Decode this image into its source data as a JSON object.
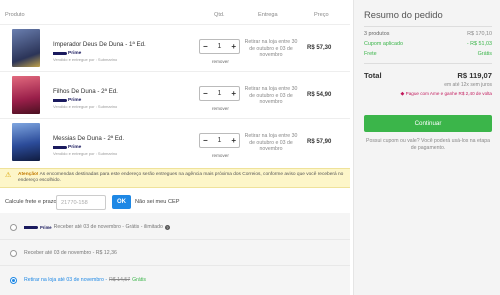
{
  "cart": {
    "headers": {
      "product": "Produto",
      "qty": "Qtd.",
      "delivery": "Entrega",
      "price": "Preço"
    },
    "items": [
      {
        "title": "Imperador Deus De Duna - 1ª Ed.",
        "prime": "Prime",
        "seller": "Vendido e entregue por : Submarino",
        "qty": "1",
        "delivery": "Retirar na loja entre 30 de outubro e 03 de novembro",
        "price": "R$ 57,30",
        "remove": "remover",
        "cover_color": "#3a4a7a"
      },
      {
        "title": "Filhos De Duna - 2ª Ed.",
        "prime": "Prime",
        "seller": "Vendido e entregue por : Submarino",
        "qty": "1",
        "delivery": "Retirar na loja entre 30 de outubro e 03 de novembro",
        "price": "R$ 54,90",
        "remove": "remover",
        "cover_color": "#b5345a"
      },
      {
        "title": "Messias De Duna - 2ª Ed.",
        "prime": "Prime",
        "seller": "Vendido e entregue por : Submarino",
        "qty": "1",
        "delivery": "Retirar na loja entre 30 de outubro e 03 de novembro",
        "price": "R$ 57,90",
        "remove": "remover",
        "cover_color": "#3a5fa8"
      }
    ],
    "qty_minus": "−",
    "qty_plus": "+"
  },
  "notice": {
    "bold": "Atenção!",
    "text": " As encomendas destinadas para este endereço serão entregues na agência mais próxima dos Correios, conforme aviso que você receberá no endereço escolhido."
  },
  "freight": {
    "label": "Calcule frete e prazo",
    "placeholder": "21770-158",
    "ok": "OK",
    "no_cep": "Não sei meu CEP"
  },
  "shipping_options": [
    {
      "prime": "Prime",
      "text": "Receber até 03 de novembro - Grátis - ilimitado",
      "info": "?"
    },
    {
      "text": "Receber até 03 de novembro - R$ 12,36"
    },
    {
      "text": "Retirar na loja até 03 de novembro - ",
      "old_price": "R$ 14,57",
      "free": " Grátis"
    }
  ],
  "summary": {
    "title": "Resumo do pedido",
    "products_label": "3 produtos",
    "products_value": "R$ 170,10",
    "coupon_label": "Cupom aplicado",
    "coupon_value": "- R$ 51,03",
    "freight_label": "Frete",
    "freight_value": "Grátis",
    "total_label": "Total",
    "total_value": "R$ 119,07",
    "installments": "em até 12x sem juros",
    "ame_text": "Pague com Ame e ganhe R$ 2,40 de volta",
    "continue": "Continuar",
    "coupon_question": "Possui cupom ou vale? Você poderá usá-los na etapa de pagamento."
  },
  "colors": {
    "accent": "#1e88e5",
    "green": "#3bb54a",
    "warning_bg": "#fdf6c9",
    "ame": "#c2185b"
  }
}
